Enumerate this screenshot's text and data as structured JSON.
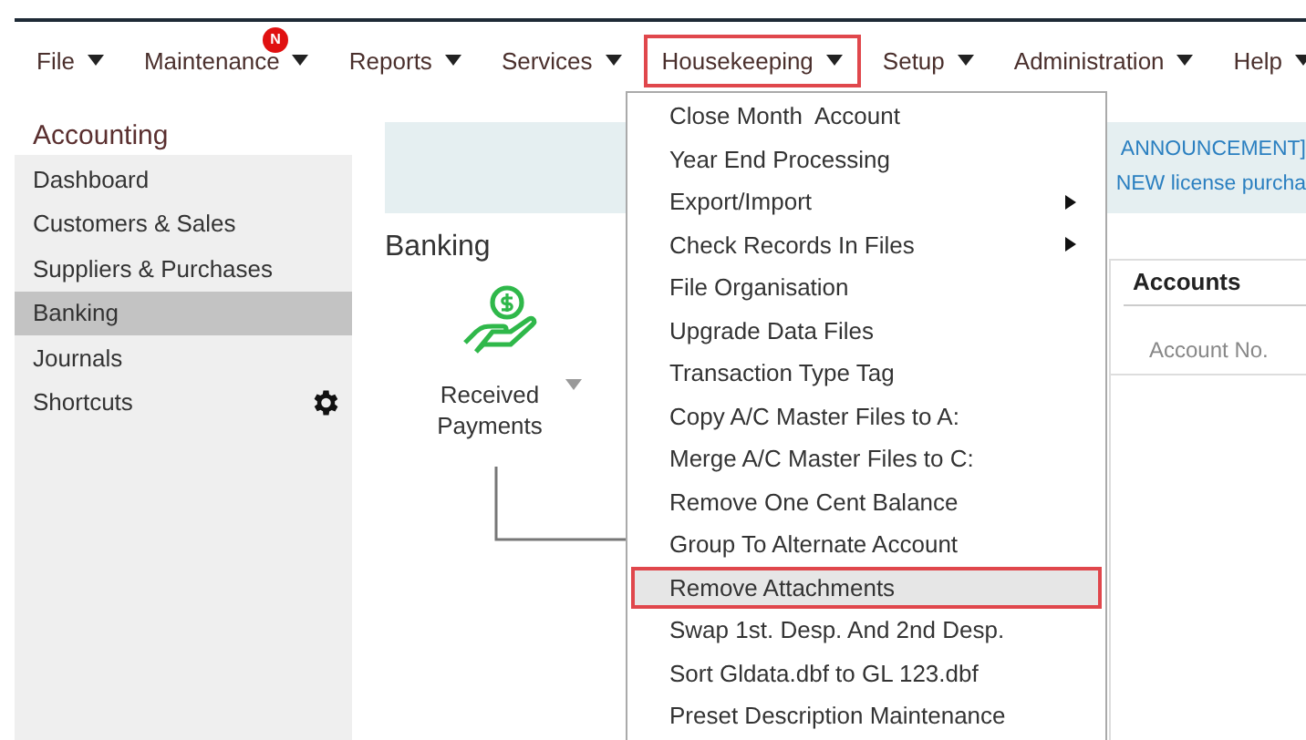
{
  "menu": [
    {
      "label": "File",
      "selected": false
    },
    {
      "label": "Maintenance",
      "selected": false,
      "badge": "N"
    },
    {
      "label": "Reports",
      "selected": false
    },
    {
      "label": "Services",
      "selected": false
    },
    {
      "label": "Housekeeping",
      "selected": true
    },
    {
      "label": "Setup",
      "selected": false
    },
    {
      "label": "Administration",
      "selected": false
    },
    {
      "label": "Help",
      "selected": false
    }
  ],
  "sidebar": {
    "title": "Accounting",
    "items": [
      {
        "label": "Dashboard",
        "selected": false,
        "settings": false
      },
      {
        "label": "Customers & Sales",
        "selected": false,
        "settings": false
      },
      {
        "label": "Suppliers & Purchases",
        "selected": false,
        "settings": false
      },
      {
        "label": "Banking",
        "selected": true,
        "settings": false
      },
      {
        "label": "Journals",
        "selected": false,
        "settings": false
      },
      {
        "label": "Shortcuts",
        "selected": false,
        "settings": true
      }
    ]
  },
  "announcement": {
    "lines": [
      "ANNOUNCEMENT]",
      "NEW license purcha"
    ]
  },
  "page": {
    "title": "Banking",
    "shortcut": {
      "label": "Received Payments"
    }
  },
  "accounts": {
    "title": "Accounts",
    "column": "Account No."
  },
  "dropdown": [
    {
      "label": "Close Month  Account",
      "submenu": false,
      "selected": false
    },
    {
      "label": "Year End Processing",
      "submenu": false,
      "selected": false
    },
    {
      "label": "Export/Import",
      "submenu": true,
      "selected": false
    },
    {
      "label": "Check Records In Files",
      "submenu": true,
      "selected": false
    },
    {
      "label": "File Organisation",
      "submenu": false,
      "selected": false
    },
    {
      "label": "Upgrade Data Files",
      "submenu": false,
      "selected": false
    },
    {
      "label": "Transaction Type Tag",
      "submenu": false,
      "selected": false
    },
    {
      "label": "Copy A/C Master Files to A:",
      "submenu": false,
      "selected": false
    },
    {
      "label": "Merge A/C Master Files to C:",
      "submenu": false,
      "selected": false
    },
    {
      "label": "Remove One Cent Balance",
      "submenu": false,
      "selected": false
    },
    {
      "label": "Group To Alternate Account",
      "submenu": false,
      "selected": false
    },
    {
      "label": "Remove Attachments",
      "submenu": false,
      "selected": true
    },
    {
      "label": "Swap 1st. Desp. And 2nd Desp.",
      "submenu": false,
      "selected": false
    },
    {
      "label": "Sort Gldata.dbf to GL 123.dbf",
      "submenu": false,
      "selected": false
    },
    {
      "label": "Preset Description Maintenance",
      "submenu": false,
      "selected": false
    }
  ]
}
